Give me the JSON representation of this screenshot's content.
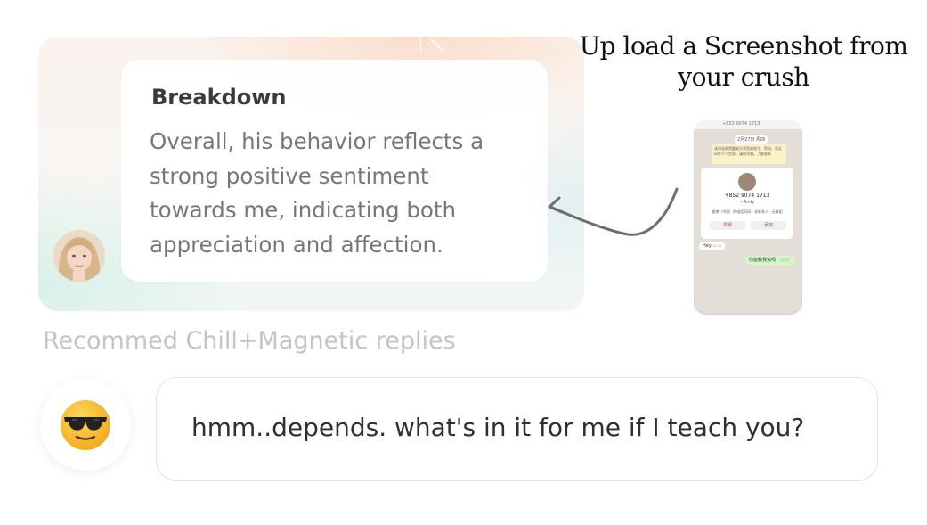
{
  "headline": {
    "line1": "Up load a Screenshot from",
    "line2": "your crush"
  },
  "breakdown": {
    "title": "Breakdown",
    "body_line1": "Overall, his behavior reflects a",
    "body_line2": "strong positive sentiment",
    "body_line3": "towards me, indicating both",
    "body_line4": "appreciation and affection."
  },
  "phone": {
    "top_number": "+852 9074 1713",
    "date": "2月27日 周四",
    "banner": "请勿轻易透露或分享您的账号、密码、验证码等个人信息，谨防诈骗。了解更多",
    "contact_number": "+852 9074 1713",
    "contact_name": "~Andy",
    "contact_desc": "香港（中国）的电话号码 · 非联系人 · 无群组",
    "block_label": "举报",
    "add_label": "添加",
    "incoming_msg": "Hey",
    "incoming_time": "11:11",
    "outgoing_msg": "你能教我说吗",
    "outgoing_time": "11:25"
  },
  "recommend": {
    "label": "Recommed Chill+Magnetic replies",
    "reply": "hmm..depends. what's in it for me if I teach you?",
    "emoji": "sunglasses-emoji"
  },
  "colors": {
    "headline": "#111111",
    "breakdown_title": "#3a3a3a",
    "breakdown_body": "#777777",
    "recommend_label": "#c4c4c4",
    "reply_text": "#2f2f2f",
    "emoji_yellow": "#f7c12e"
  }
}
